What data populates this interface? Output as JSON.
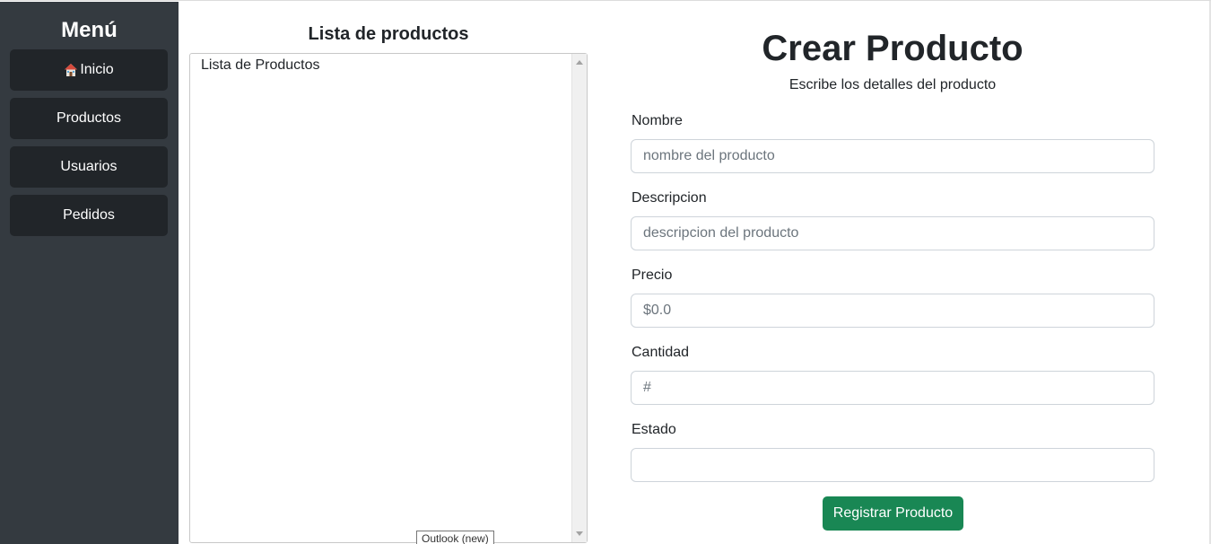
{
  "sidebar": {
    "title": "Menú",
    "items": [
      {
        "label": "Inicio",
        "icon": "house-icon"
      },
      {
        "label": "Productos"
      },
      {
        "label": "Usuarios"
      },
      {
        "label": "Pedidos"
      }
    ]
  },
  "product_list": {
    "title": "Lista de productos",
    "items": [
      "Lista de Productos"
    ]
  },
  "form": {
    "title": "Crear Producto",
    "subtitle": "Escribe los detalles del producto",
    "fields": [
      {
        "label": "Nombre",
        "placeholder": "nombre del producto"
      },
      {
        "label": "Descripcion",
        "placeholder": "descripcion del producto"
      },
      {
        "label": "Precio",
        "placeholder": "$0.0"
      },
      {
        "label": "Cantidad",
        "placeholder": "#"
      },
      {
        "label": "Estado",
        "placeholder": ""
      }
    ],
    "submit_label": "Registrar Producto"
  },
  "tooltip": "Outlook (new)",
  "colors": {
    "sidebar_bg": "#343a40",
    "nav_button_bg": "#212529",
    "submit_button_bg": "#198754"
  }
}
